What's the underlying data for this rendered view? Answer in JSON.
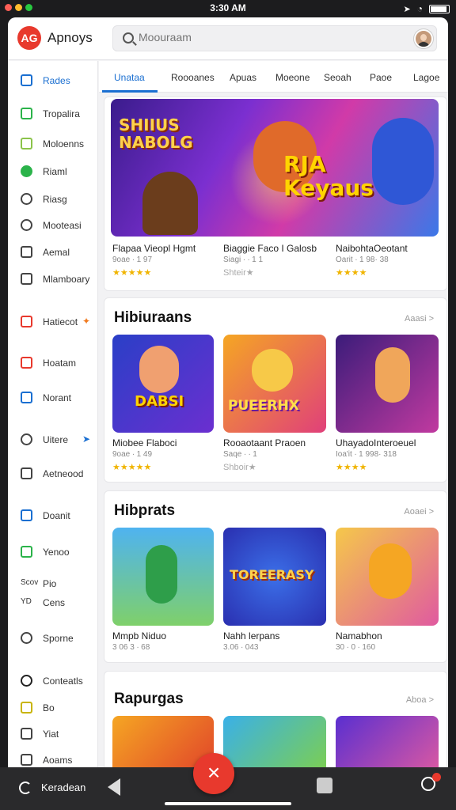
{
  "status": {
    "time": "3:30 AM"
  },
  "app": {
    "name": "Apnoys",
    "logo": "AG"
  },
  "search": {
    "placeholder": "Moouraam"
  },
  "sidebar": {
    "items": [
      {
        "label": "Rades",
        "color": "#1a6fd1",
        "active": true
      },
      {
        "label": "Tropalira",
        "color": "#2bb34a"
      },
      {
        "label": "Moloenns",
        "color": "#8bc34a"
      },
      {
        "label": "Riaml",
        "color": "#2bb34a"
      },
      {
        "label": "Riasg",
        "color": "#444"
      },
      {
        "label": "Mooteasi",
        "color": "#444"
      },
      {
        "label": "Aemal",
        "color": "#444"
      },
      {
        "label": "Mlamboary",
        "color": "#444"
      },
      {
        "label": "Hatiecot",
        "color": "#e8392d"
      },
      {
        "label": "Hoatam",
        "color": "#e8392d"
      },
      {
        "label": "Norant",
        "color": "#1a6fd1"
      },
      {
        "label": "Uitere",
        "color": "#444"
      },
      {
        "label": "Aetneood",
        "color": "#444"
      },
      {
        "label": "Doanit",
        "color": "#1a6fd1"
      },
      {
        "label": "Yenoo",
        "color": "#2bb34a"
      },
      {
        "label": "Cens",
        "color": "#444"
      },
      {
        "label": "Sporne",
        "color": "#444"
      },
      {
        "label": "Conteatls",
        "color": "#222"
      },
      {
        "label": "Bo",
        "color": "#c8b400"
      },
      {
        "label": "Yiat",
        "color": "#444"
      },
      {
        "label": "Aoams",
        "color": "#444"
      }
    ],
    "extra_left_labels": [
      "Scov",
      "Pio",
      "YD"
    ]
  },
  "tabs": [
    "Unataa",
    "Roooanes",
    "Apuas",
    "Moeone",
    "Seoah",
    "Paoe",
    "Lagoe"
  ],
  "featured": {
    "banner_title_a": "SHIIUS NABOLG",
    "banner_title_b": "RJA Keyaus",
    "items": [
      {
        "title": "Flapaa Vieopl Hgmt",
        "sub": "9oae ∙ 1 97",
        "stars": "★★★★★",
        "gray": false
      },
      {
        "title": "Biaggie Faco I Galosb",
        "sub": "Siagi ∙ ∙ 1 1",
        "stars": "Shteir★",
        "gray": true
      },
      {
        "title": "NaibohtaOeotant",
        "sub": "Oarit ∙ 1 98· 38",
        "stars": "★★★★",
        "gray": false
      }
    ]
  },
  "sections": [
    {
      "title": "Hibiuraans",
      "see_all": "Aaasi >",
      "items": [
        {
          "title": "Miobee Flaboci",
          "sub": "9oae ∙ 1 49",
          "stars": "★★★★★",
          "gray": false,
          "art": "DABSI"
        },
        {
          "title": "Rooaotaant Praoen",
          "sub": "Saqe ∙ ∙ 1",
          "stars": "Shboir★",
          "gray": true,
          "art": "PUEERHX"
        },
        {
          "title": "UhayadoInteroeuel",
          "sub": "Ioa'it ∙ 1 998· 318",
          "stars": "★★★★",
          "gray": false,
          "art": ""
        }
      ]
    },
    {
      "title": "Hibprats",
      "see_all": "Aoaei >",
      "items": [
        {
          "title": "Mmpb Niduo",
          "sub": "3 06 3 ∙ 68",
          "art": ""
        },
        {
          "title": "Nahh lerpans",
          "sub": "3.06 ∙ 043",
          "art": "TOREERASY"
        },
        {
          "title": "Namabhon",
          "sub": "30 ∙ 0 ∙ 160",
          "art": ""
        }
      ]
    },
    {
      "title": "Rapurgas",
      "see_all": "Aboa >",
      "items": []
    }
  ],
  "bottom": {
    "label": "Keradean",
    "fab": "×"
  },
  "colors": {
    "accent": "#1a6fd1",
    "brand": "#e8392d"
  }
}
